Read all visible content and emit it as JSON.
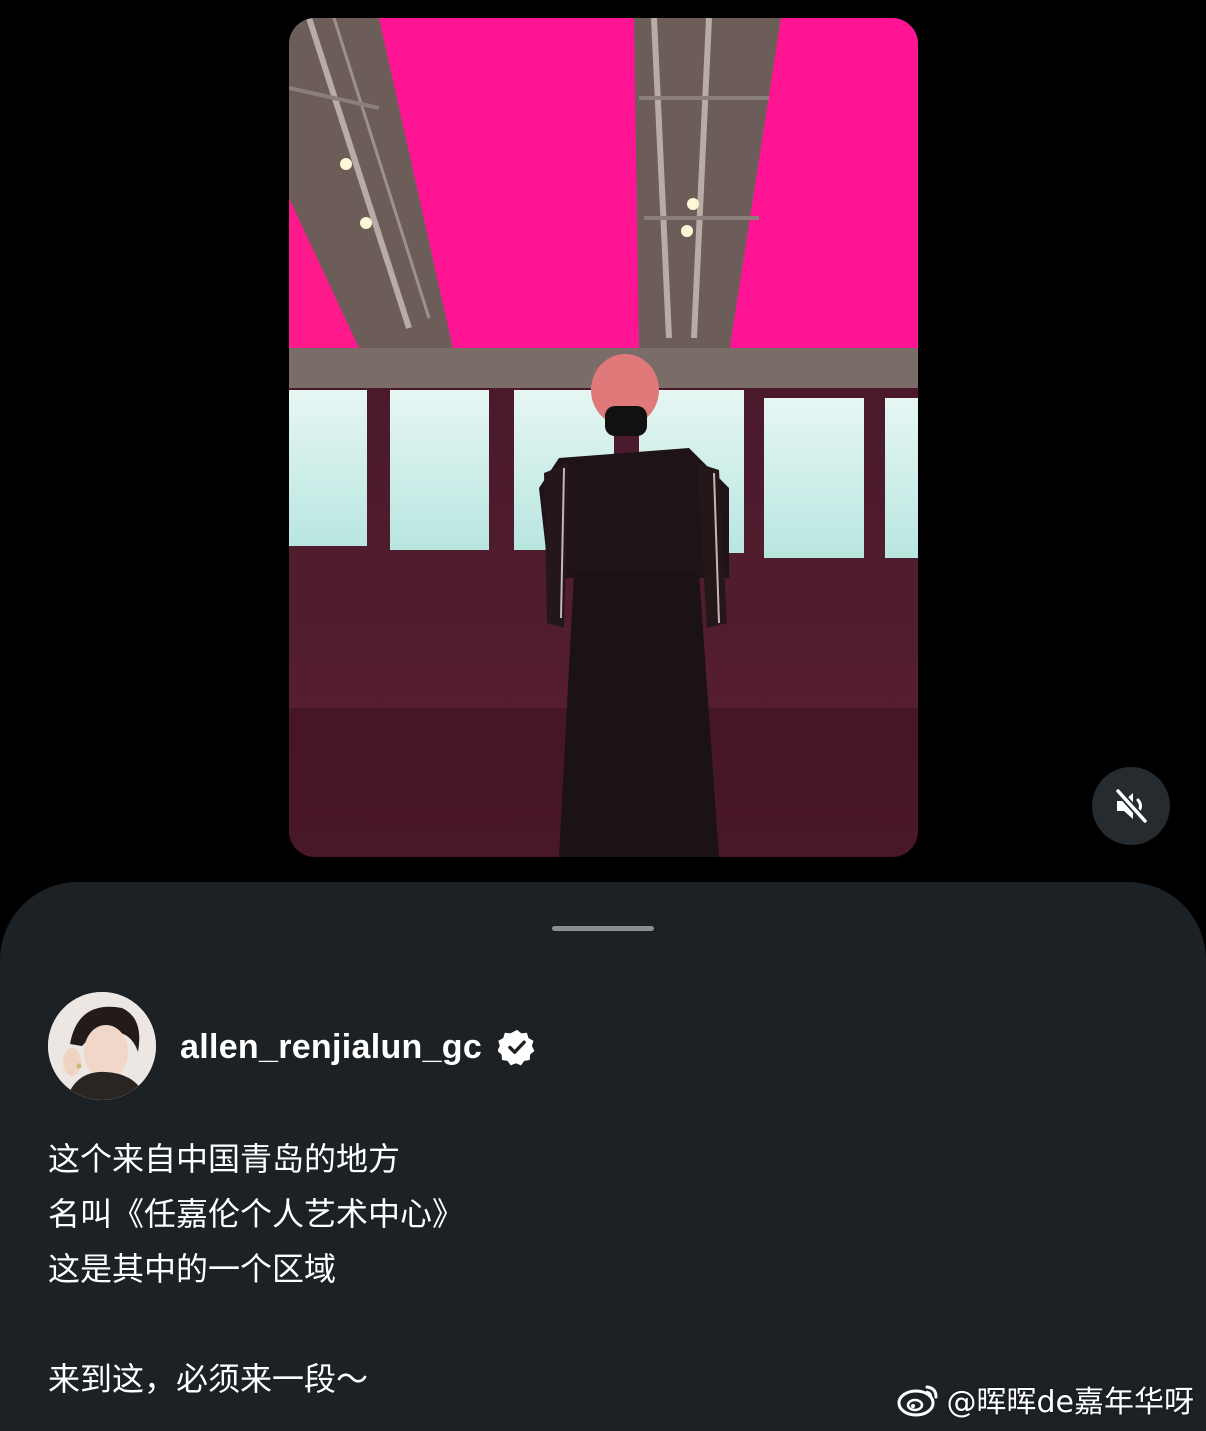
{
  "post": {
    "username": "allen_renjialun_gc",
    "caption_lines": [
      "这个来自中国青岛的地方",
      "名叫《任嘉伦个人艺术中心》",
      "这是其中的一个区域",
      "来到这，必须来一段～"
    ]
  },
  "icons": {
    "mute": "speaker-muted-icon",
    "verified": "verified-badge-icon",
    "weibo": "weibo-logo-icon"
  },
  "watermark": {
    "text": "@晖晖de嘉年华呀"
  },
  "colors": {
    "sheet_background": "#1c2126",
    "ceiling_panel": "#ff1a8c",
    "window_panel": "#cfeeea"
  }
}
